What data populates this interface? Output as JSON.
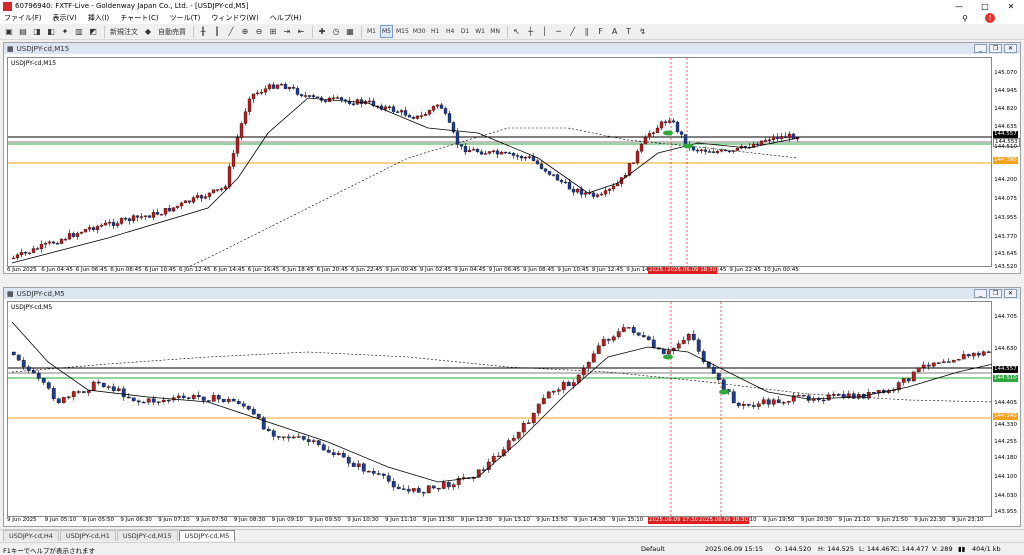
{
  "window": {
    "title": "60796940: FXTF-Live - Goldenway Japan Co., Ltd. - [USDJPY-cd,M5]"
  },
  "menu": [
    "ファイル(F)",
    "表示(V)",
    "挿入(I)",
    "チャート(C)",
    "ツール(T)",
    "ウィンドウ(W)",
    "ヘルプ(H)"
  ],
  "toolbar": {
    "new_order": "新規注文",
    "auto_trading": "自動売買",
    "timeframes": [
      "M1",
      "M5",
      "M15",
      "M30",
      "H1",
      "H4",
      "D1",
      "W1",
      "MN"
    ],
    "active_tf": "M5"
  },
  "chart_top": {
    "title": "USDJPY-cd,M15",
    "symbol": "USDJPY-cd,M15",
    "y_ticks": [
      "145.070",
      "144.945",
      "144.820",
      "144.635",
      "144.510",
      "144.385",
      "144.200",
      "144.075",
      "143.955",
      "143.770",
      "143.645",
      "143.520"
    ],
    "price_tags": {
      "bid": "144.557",
      "ask": "144.553",
      "green": "144.510",
      "orange": "144.390"
    },
    "x_ticks": [
      "6 Jun 2025",
      "6 Jun 04:45",
      "6 Jun 06:45",
      "6 Jun 08:45",
      "6 Jun 10:45",
      "6 Jun 12:45",
      "6 Jun 14:45",
      "6 Jun 16:45",
      "6 Jun 18:45",
      "6 Jun 20:45",
      "6 Jun 22:45",
      "9 Jun 00:45",
      "9 Jun 02:45",
      "9 Jun 04:45",
      "9 Jun 06:45",
      "9 Jun 08:45",
      "9 Jun 10:45",
      "9 Jun 12:45",
      "9 Jun 14:45",
      "9 Jun 18:45",
      "9 Jun 20:45",
      "9 Jun 22:45",
      "10 Jun 00:45"
    ],
    "red_x_labels": [
      "2025.06.09 16:30",
      "2025.06.09 18:30"
    ]
  },
  "chart_bottom": {
    "title": "USDJPY-cd,M5",
    "symbol": "USDJPY-cd,M5",
    "y_ticks": [
      "144.705",
      "144.630",
      "144.557",
      "144.480",
      "144.405",
      "144.330",
      "144.255",
      "144.180",
      "144.100",
      "144.030",
      "143.955"
    ],
    "price_tags": {
      "bid": "144.557",
      "ask": "144.553",
      "green": "144.510",
      "orange": "144.340"
    },
    "x_ticks": [
      "9 Jun 2025",
      "9 Jun 05:10",
      "9 Jun 05:50",
      "9 Jun 06:30",
      "9 Jun 07:10",
      "9 Jun 07:50",
      "9 Jun 08:30",
      "9 Jun 09:10",
      "9 Jun 09:50",
      "9 Jun 10:30",
      "9 Jun 11:10",
      "9 Jun 11:50",
      "9 Jun 12:30",
      "9 Jun 13:10",
      "9 Jun 13:50",
      "9 Jun 14:30",
      "9 Jun 15:10",
      "9 Jun 15:50",
      "9 Jun 16:30",
      "9 Jun 19:10",
      "9 Jun 19:50",
      "9 Jun 20:30",
      "9 Jun 21:10",
      "9 Jun 21:50",
      "9 Jun 22:30",
      "9 Jun 23:10"
    ],
    "red_x_labels": [
      "2025.06.09 17:30",
      "2025.06.09 18:30"
    ]
  },
  "tabs": [
    "USDJPY-cd,H4",
    "USDJPY-cd,H1",
    "USDJPY-cd,M15",
    "USDJPY-cd,M5"
  ],
  "active_tab": "USDJPY-cd,M5",
  "status": {
    "help": "F1キーでヘルプが表示されます",
    "profile": "Default",
    "datetime": "2025.06.09 15:15",
    "open": "O: 144.520",
    "high": "H: 144.525",
    "low": "L: 144.467",
    "close": "C: 144.477",
    "volume": "V: 289",
    "traffic": "404/1 kb"
  },
  "colors": {
    "bull": "#b0201e",
    "bear": "#1f3d8c",
    "ma": "#000000",
    "orange_line": "#f5a020",
    "green_line": "#2eaa3c",
    "red_vline": "#e02020"
  }
}
